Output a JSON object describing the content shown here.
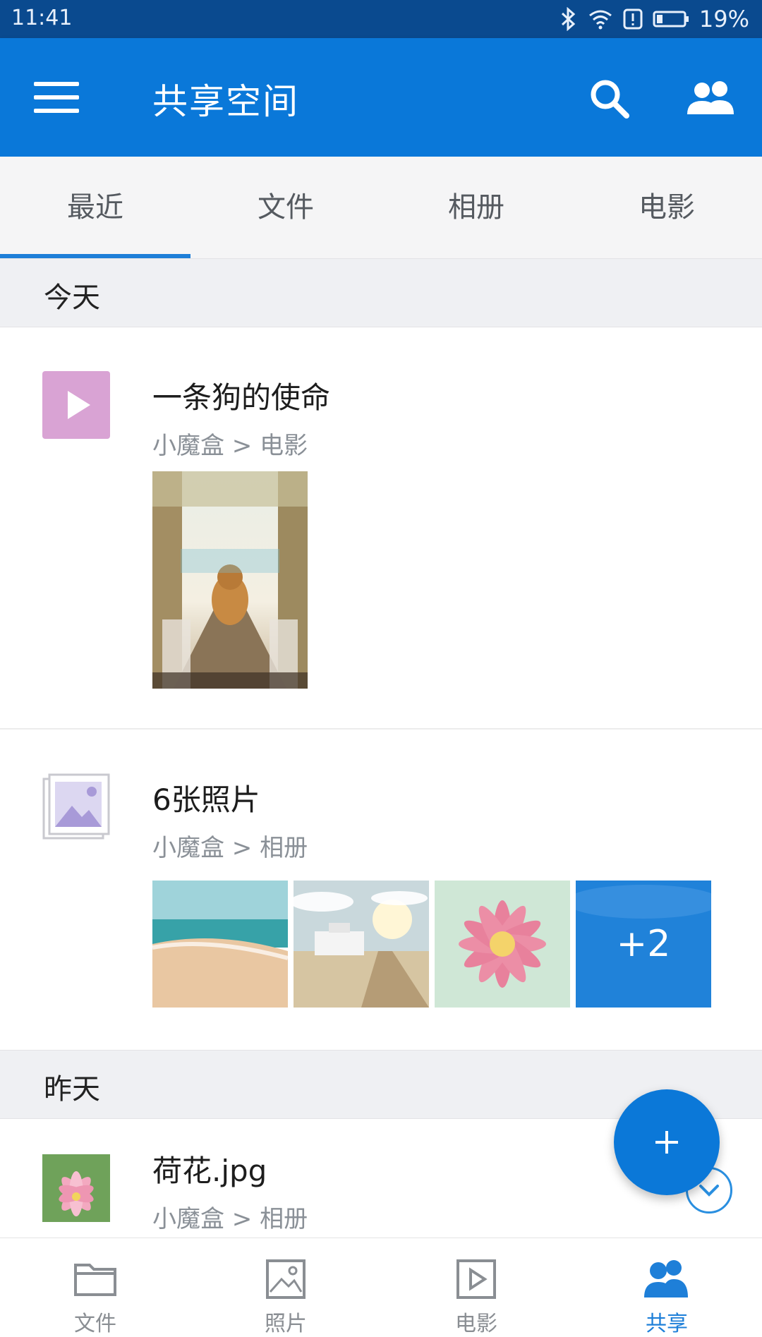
{
  "status_bar": {
    "time": "11:41",
    "battery": "19%"
  },
  "app_bar": {
    "title": "共享空间"
  },
  "tabs": [
    {
      "label": "最近",
      "active": true
    },
    {
      "label": "文件",
      "active": false
    },
    {
      "label": "相册",
      "active": false
    },
    {
      "label": "电影",
      "active": false
    }
  ],
  "sections": {
    "today": "今天",
    "yesterday": "昨天"
  },
  "feed": [
    {
      "title": "一条狗的使命",
      "path": "小魔盒 > 电影",
      "icon": "play-icon"
    },
    {
      "title": "6张照片",
      "path": "小魔盒 > 相册",
      "icon": "photo-album-icon",
      "more_count": "+2"
    },
    {
      "title": "荷花.jpg",
      "path": "小魔盒 > 相册",
      "icon": "lotus-thumbnail"
    }
  ],
  "bottom_nav": [
    {
      "label": "文件",
      "icon": "folder-icon"
    },
    {
      "label": "照片",
      "icon": "image-icon"
    },
    {
      "label": "电影",
      "icon": "play-icon"
    },
    {
      "label": "共享",
      "icon": "people-icon",
      "active": true
    }
  ],
  "colors": {
    "primary": "#0a78d9",
    "status_bar": "#0a4a8f",
    "accent": "#1e7fd8"
  }
}
